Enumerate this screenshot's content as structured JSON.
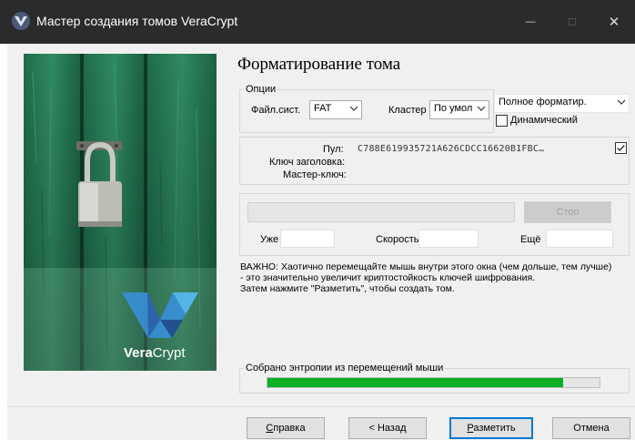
{
  "window": {
    "title": "Мастер создания томов VeraCrypt",
    "minimize_glyph": "—",
    "maximize_glyph": "☐",
    "close_glyph": "✕"
  },
  "colors": {
    "accent": "#0078d7",
    "progress": "#06b025",
    "titlebar": "#2b2b2b"
  },
  "brand": {
    "logo_text_vera": "Vera",
    "logo_text_crypt": "Crypt"
  },
  "page": {
    "heading": "Форматирование тома"
  },
  "options": {
    "legend": "Опции",
    "fs_label": "Файл.сист.",
    "fs_value": "FAT",
    "cluster_label": "Кластер",
    "cluster_value": "По умол",
    "format_mode": "Полное форматир.",
    "dynamic_label": "Динамический",
    "dynamic_checked": false
  },
  "keys": {
    "pool_label": "Пул:",
    "pool_value": "C788E619935721A626CDCC16620B1FBC…",
    "header_key_label": "Ключ заголовка:",
    "master_key_label": "Мастер-ключ:",
    "show_checked": true
  },
  "progress": {
    "stop_label": "Стоп",
    "done_label": "Уже",
    "speed_label": "Скорость",
    "left_label": "Ещё"
  },
  "info": {
    "line1": "ВАЖНО: Хаотично перемещайте мышь внутри этого окна (чем дольше, тем лучше)",
    "line2": "- это значительно увеличит криптостойкость ключей шифрования.",
    "line3": "Затем нажмите \"Разметить\", чтобы создать том."
  },
  "entropy": {
    "legend": "Собрано энтропии из перемещений мыши",
    "fraction": 0.89
  },
  "buttons": {
    "help_prefix": "С",
    "help_rest": "правка",
    "back": "< Назад",
    "format_prefix": "Р",
    "format_rest": "азметить",
    "cancel": "Отмена"
  }
}
